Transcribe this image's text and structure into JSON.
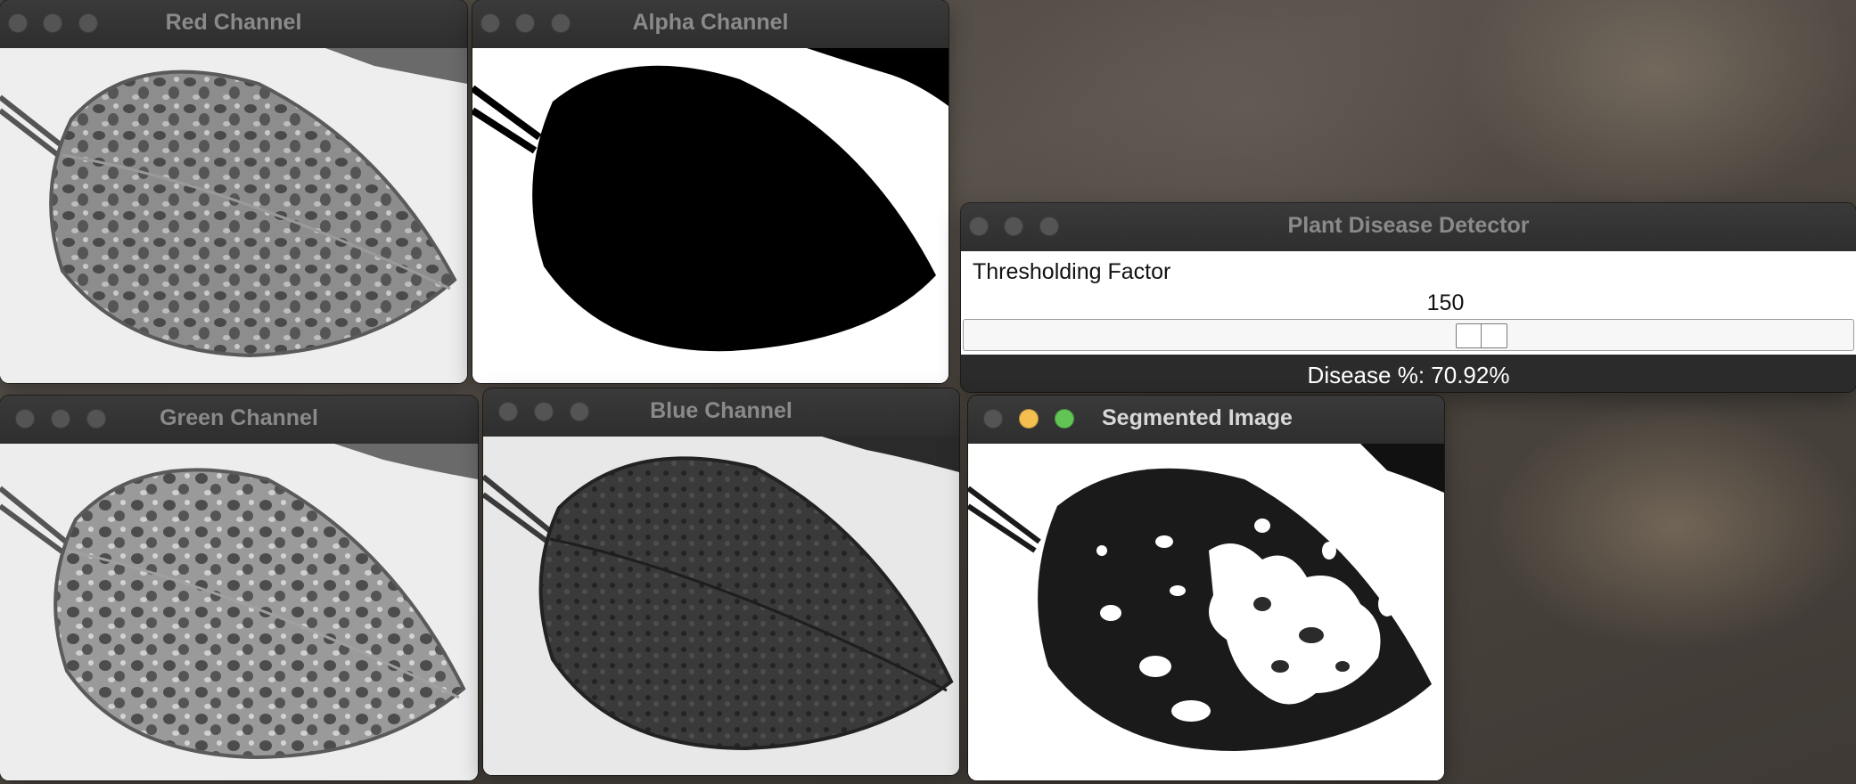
{
  "windows": {
    "red": {
      "title": "Red Channel"
    },
    "alpha": {
      "title": "Alpha Channel"
    },
    "green": {
      "title": "Green Channel"
    },
    "blue": {
      "title": "Blue Channel"
    },
    "segmented": {
      "title": "Segmented Image"
    },
    "detector": {
      "title": "Plant Disease Detector",
      "slider_label": "Thresholding Factor",
      "slider_value": "150",
      "result_text": "Disease %: 70.92%"
    }
  },
  "traffic_light_colors": {
    "inactive": "#545454",
    "close": "#ed6a5e",
    "minimize": "#f4bf4f",
    "zoom": "#61c554"
  },
  "accent_colors": {
    "leaf_dark": "#1a1a1a",
    "leaf_mid": "#6f6f6f",
    "background_light": "#f0f0f0"
  }
}
